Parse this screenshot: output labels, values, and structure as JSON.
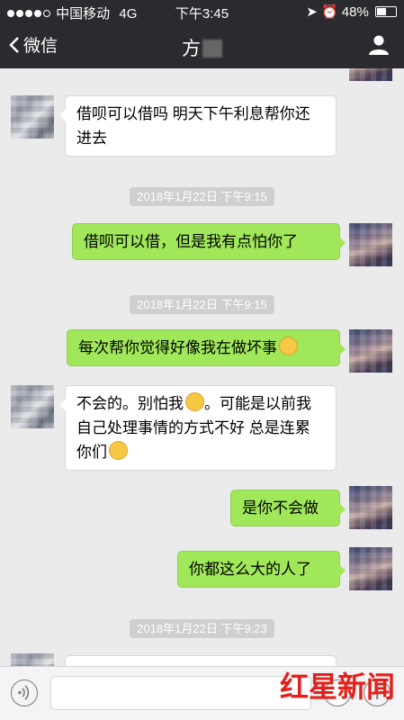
{
  "status": {
    "carrier": "中国移动",
    "network": "4G",
    "time": "下午3:45",
    "battery": "48%"
  },
  "nav": {
    "back_label": "微信",
    "title": "方"
  },
  "messages": [
    {
      "side": "in",
      "text": "借呗可以借吗 明天下午利息帮你还进去"
    },
    {
      "time": "2018年1月22日 下午9:15"
    },
    {
      "side": "out",
      "text": "借呗可以借，但是我有点怕你了"
    },
    {
      "time": "2018年1月22日 下午9:15"
    },
    {
      "side": "out",
      "text": "每次帮你觉得好像我在做坏事"
    },
    {
      "side": "in",
      "text_a": "不会的。别怕我",
      "text_b": "。可能是以前我自己处理事情的方式不好 总是连累你们"
    },
    {
      "side": "out",
      "text": "是你不会做"
    },
    {
      "side": "out",
      "text": "你都这么大的人了"
    },
    {
      "time": "2018年1月22日 下午9:23"
    }
  ],
  "watermark": {
    "text": "红星新闻"
  },
  "colors": {
    "bar": "#2b2b2f",
    "bubble_out": "#a0e75a",
    "bubble_in": "#ffffff",
    "background": "#ebebeb"
  }
}
